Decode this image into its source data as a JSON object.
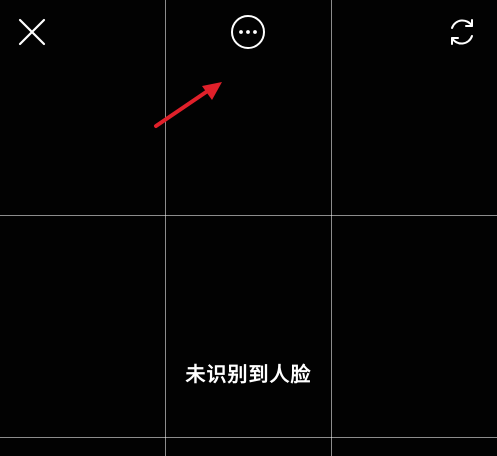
{
  "camera": {
    "status_text": "未识别到人脸"
  },
  "icons": {
    "close": "close-icon",
    "more": "more-icon",
    "switch_camera": "switch-camera-icon"
  },
  "colors": {
    "background": "#000000",
    "grid_line": "#8c8c8c",
    "icon": "#ffffff",
    "annotation": "#e0202a"
  }
}
